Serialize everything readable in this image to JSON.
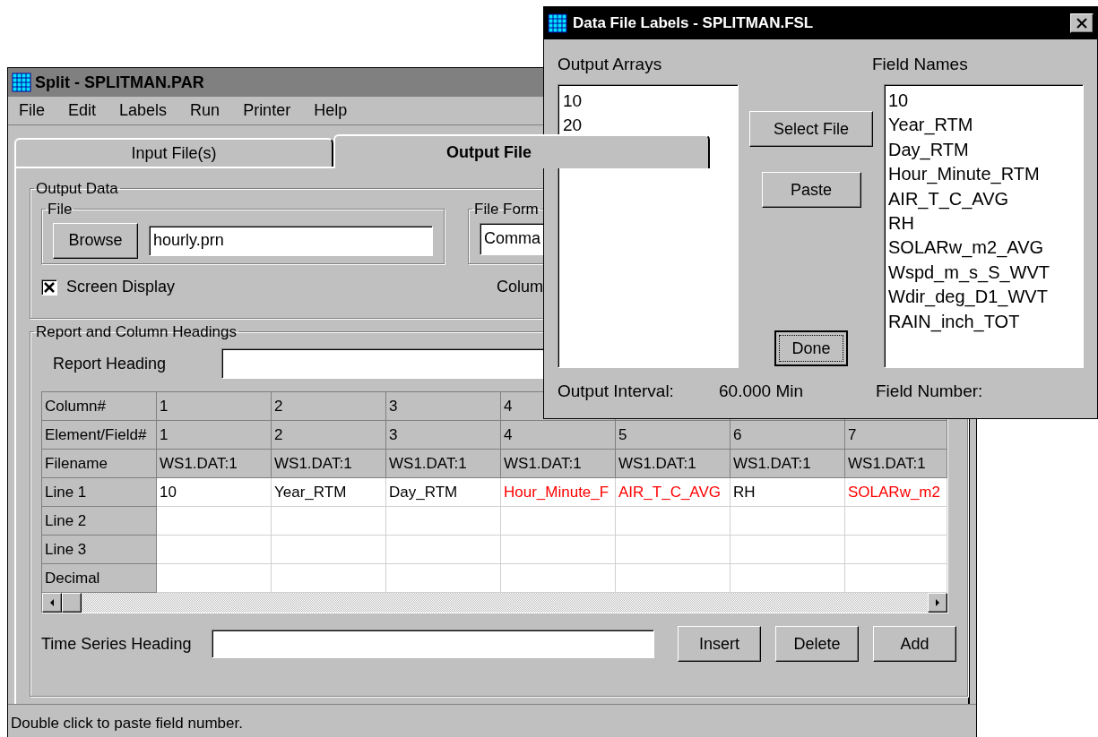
{
  "main_window": {
    "title": "Split - SPLITMAN.PAR",
    "menu": [
      "File",
      "Edit",
      "Labels",
      "Run",
      "Printer",
      "Help"
    ],
    "tabs": [
      {
        "label": "Input File(s)",
        "selected": false
      },
      {
        "label": "Output File",
        "selected": true
      }
    ],
    "output_data": {
      "title": "Output Data",
      "file_group": {
        "title": "File",
        "browse_button": "Browse",
        "file_value": "hourly.prn"
      },
      "format_group": {
        "title": "File Form",
        "value": "Comma"
      },
      "screen_display": {
        "label": "Screen Display",
        "checked": true
      },
      "column_label": "Colum"
    },
    "headings": {
      "title": "Report and Column Headings",
      "report_heading_label": "Report Heading",
      "grid": {
        "rows": [
          {
            "header": "Column#",
            "kind": "header",
            "cells": [
              {
                "text": "1"
              },
              {
                "text": "2"
              },
              {
                "text": "3"
              },
              {
                "text": "4"
              }
            ]
          },
          {
            "header": "Element/Field#",
            "kind": "header",
            "cells": [
              {
                "text": "1"
              },
              {
                "text": "2"
              },
              {
                "text": "3"
              },
              {
                "text": "4"
              },
              {
                "text": "5"
              },
              {
                "text": "6"
              },
              {
                "text": "7"
              }
            ]
          },
          {
            "header": "Filename",
            "kind": "header",
            "cells": [
              {
                "text": "WS1.DAT:1"
              },
              {
                "text": "WS1.DAT:1"
              },
              {
                "text": "WS1.DAT:1"
              },
              {
                "text": "WS1.DAT:1"
              },
              {
                "text": "WS1.DAT:1"
              },
              {
                "text": "WS1.DAT:1"
              },
              {
                "text": "WS1.DAT:1"
              }
            ]
          },
          {
            "header": "Line 1",
            "kind": "data",
            "cells": [
              {
                "text": "10",
                "color": "#000000"
              },
              {
                "text": "Year_RTM",
                "color": "#000000"
              },
              {
                "text": "Day_RTM",
                "color": "#000000"
              },
              {
                "text": "Hour_Minute_F",
                "color": "#ff0000"
              },
              {
                "text": "AIR_T_C_AVG",
                "color": "#ff0000"
              },
              {
                "text": "RH",
                "color": "#000000"
              },
              {
                "text": "SOLARw_m2",
                "color": "#ff0000"
              }
            ]
          },
          {
            "header": "Line 2",
            "kind": "data"
          },
          {
            "header": "Line 3",
            "kind": "data"
          },
          {
            "header": "Decimal",
            "kind": "data"
          }
        ]
      },
      "time_series_label": "Time Series Heading",
      "buttons": [
        "Insert",
        "Delete",
        "Add"
      ]
    },
    "status_bar": "Double click to paste field number."
  },
  "dialog": {
    "title": "Data File Labels - SPLITMAN.FSL",
    "output_arrays_label": "Output Arrays",
    "output_arrays": [
      "10",
      "20"
    ],
    "buttons": [
      {
        "label": "Select File",
        "focused": false
      },
      {
        "label": "Paste",
        "focused": false
      },
      {
        "label": "Done",
        "focused": true
      }
    ],
    "field_names_label": "Field Names",
    "field_names": [
      "10",
      "Year_RTM",
      "Day_RTM",
      "Hour_Minute_RTM",
      "AIR_T_C_AVG",
      "RH",
      "SOLARw_m2_AVG",
      "Wspd_m_s_S_WVT",
      "Wdir_deg_D1_WVT",
      "RAIN_inch_TOT"
    ],
    "output_interval_label": "Output Interval:",
    "output_interval_value": "60.000 Min",
    "field_number_label": "Field Number:"
  }
}
